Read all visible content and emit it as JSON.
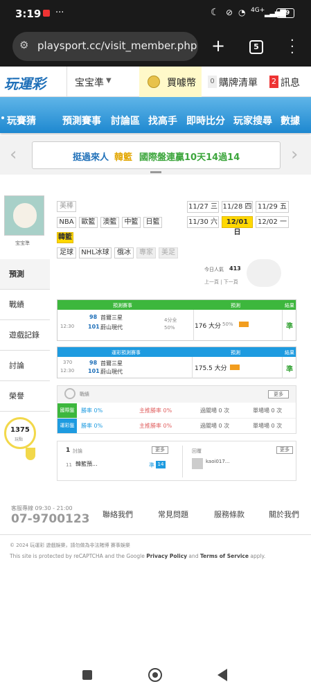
{
  "status": {
    "time": "3:19",
    "dots": "···",
    "network": "4G+",
    "battery": "89"
  },
  "browser": {
    "url": "playsport.cc/visit_member.php",
    "tabs_count": "5"
  },
  "site": {
    "logo": "玩運彩",
    "user_name": "宝宝準",
    "buy_label": "買噱幣",
    "cart_count": "0",
    "cart_label": "購牌清單",
    "msg_count": "2",
    "msg_label": "訊息"
  },
  "nav": [
    "玩賽猜",
    "預測賽事",
    "討論區",
    "找高手",
    "即時比分",
    "玩家搜尋",
    "數據"
  ],
  "banner": {
    "text_a": "挺過來人",
    "text_b": "韓籃",
    "text_c": "國際盤連贏10天14過14"
  },
  "profile": {
    "name": "宝宝準"
  },
  "tags_row1": [
    "美棒"
  ],
  "tags_row2": [
    "NBA",
    "歐籃",
    "澳籃",
    "中籃",
    "日籃"
  ],
  "tags_row3": [
    "韓籃"
  ],
  "tags_row4": [
    "足球",
    "NHL冰球",
    "俄冰",
    "專家",
    "美足"
  ],
  "dates": [
    {
      "label": "11/27 三",
      "hl": false
    },
    {
      "label": "11/28 四",
      "hl": false
    },
    {
      "label": "11/29 五",
      "hl": false
    },
    {
      "label": "11/30 六",
      "hl": false
    },
    {
      "label": "12/01 日",
      "hl": true
    },
    {
      "label": "12/02 一",
      "hl": false
    }
  ],
  "stats": {
    "views_label": "今日人氣",
    "views": "413",
    "note": "上一頁 | 下一頁"
  },
  "sidebar": [
    "預測",
    "戰績",
    "遊戲記錄",
    "討論",
    "榮譽"
  ],
  "points": {
    "value": "1375",
    "label": "玩點"
  },
  "table1": {
    "head": [
      "預測賽事",
      "預測",
      "結果"
    ],
    "time": "12:30",
    "num_a": "98",
    "num_b": "101",
    "team_a": "首爾三星",
    "team_b": "蔚山現代",
    "mid": "4分全",
    "mid2": "50%",
    "pick": "176 大分",
    "pick_pct": "50%",
    "result": "準"
  },
  "table2": {
    "head": [
      "運彩預測賽事",
      "預測",
      "結果"
    ],
    "time": "370",
    "time2": "12:30",
    "num_a": "98",
    "num_b": "101",
    "team_a": "首爾三星",
    "team_b": "蔚山現代",
    "pick": "175.5 大分",
    "result": "準"
  },
  "summary": {
    "title": "戰績",
    "btn": "更多",
    "rows": [
      {
        "label": "國際盤",
        "color": "#3db73d",
        "cells": [
          "勝率 0%",
          "主推勝率 0%",
          "過關場 0 次",
          "單場場 0 次"
        ]
      },
      {
        "label": "運彩盤",
        "color": "#1e9be0",
        "cells": [
          "勝率 0%",
          "主推勝率 0%",
          "過關場 0 次",
          "單場場 0 次"
        ]
      }
    ]
  },
  "posts": {
    "left": {
      "count": "1",
      "label": "討論",
      "btn": "更多",
      "time": "11",
      "title": "韓籃預...",
      "badge": "14"
    },
    "right": {
      "label": "回覆",
      "btn": "更多",
      "user": "kaoi017..."
    }
  },
  "footer": {
    "service_label": "客服專線 09:30 - 21:00",
    "phone": "07-9700123",
    "links": [
      "聯絡我們",
      "常見問題",
      "服務條款",
      "關於我們"
    ],
    "copyright": "© 2024 玩運彩 遊戲娛樂，請勿做為非法賭博 賽事娛樂",
    "recaptcha_a": "This site is protected by reCAPTCHA and the Google",
    "privacy": "Privacy Policy",
    "and": "and",
    "terms": "Terms of Service",
    "apply": "apply."
  }
}
